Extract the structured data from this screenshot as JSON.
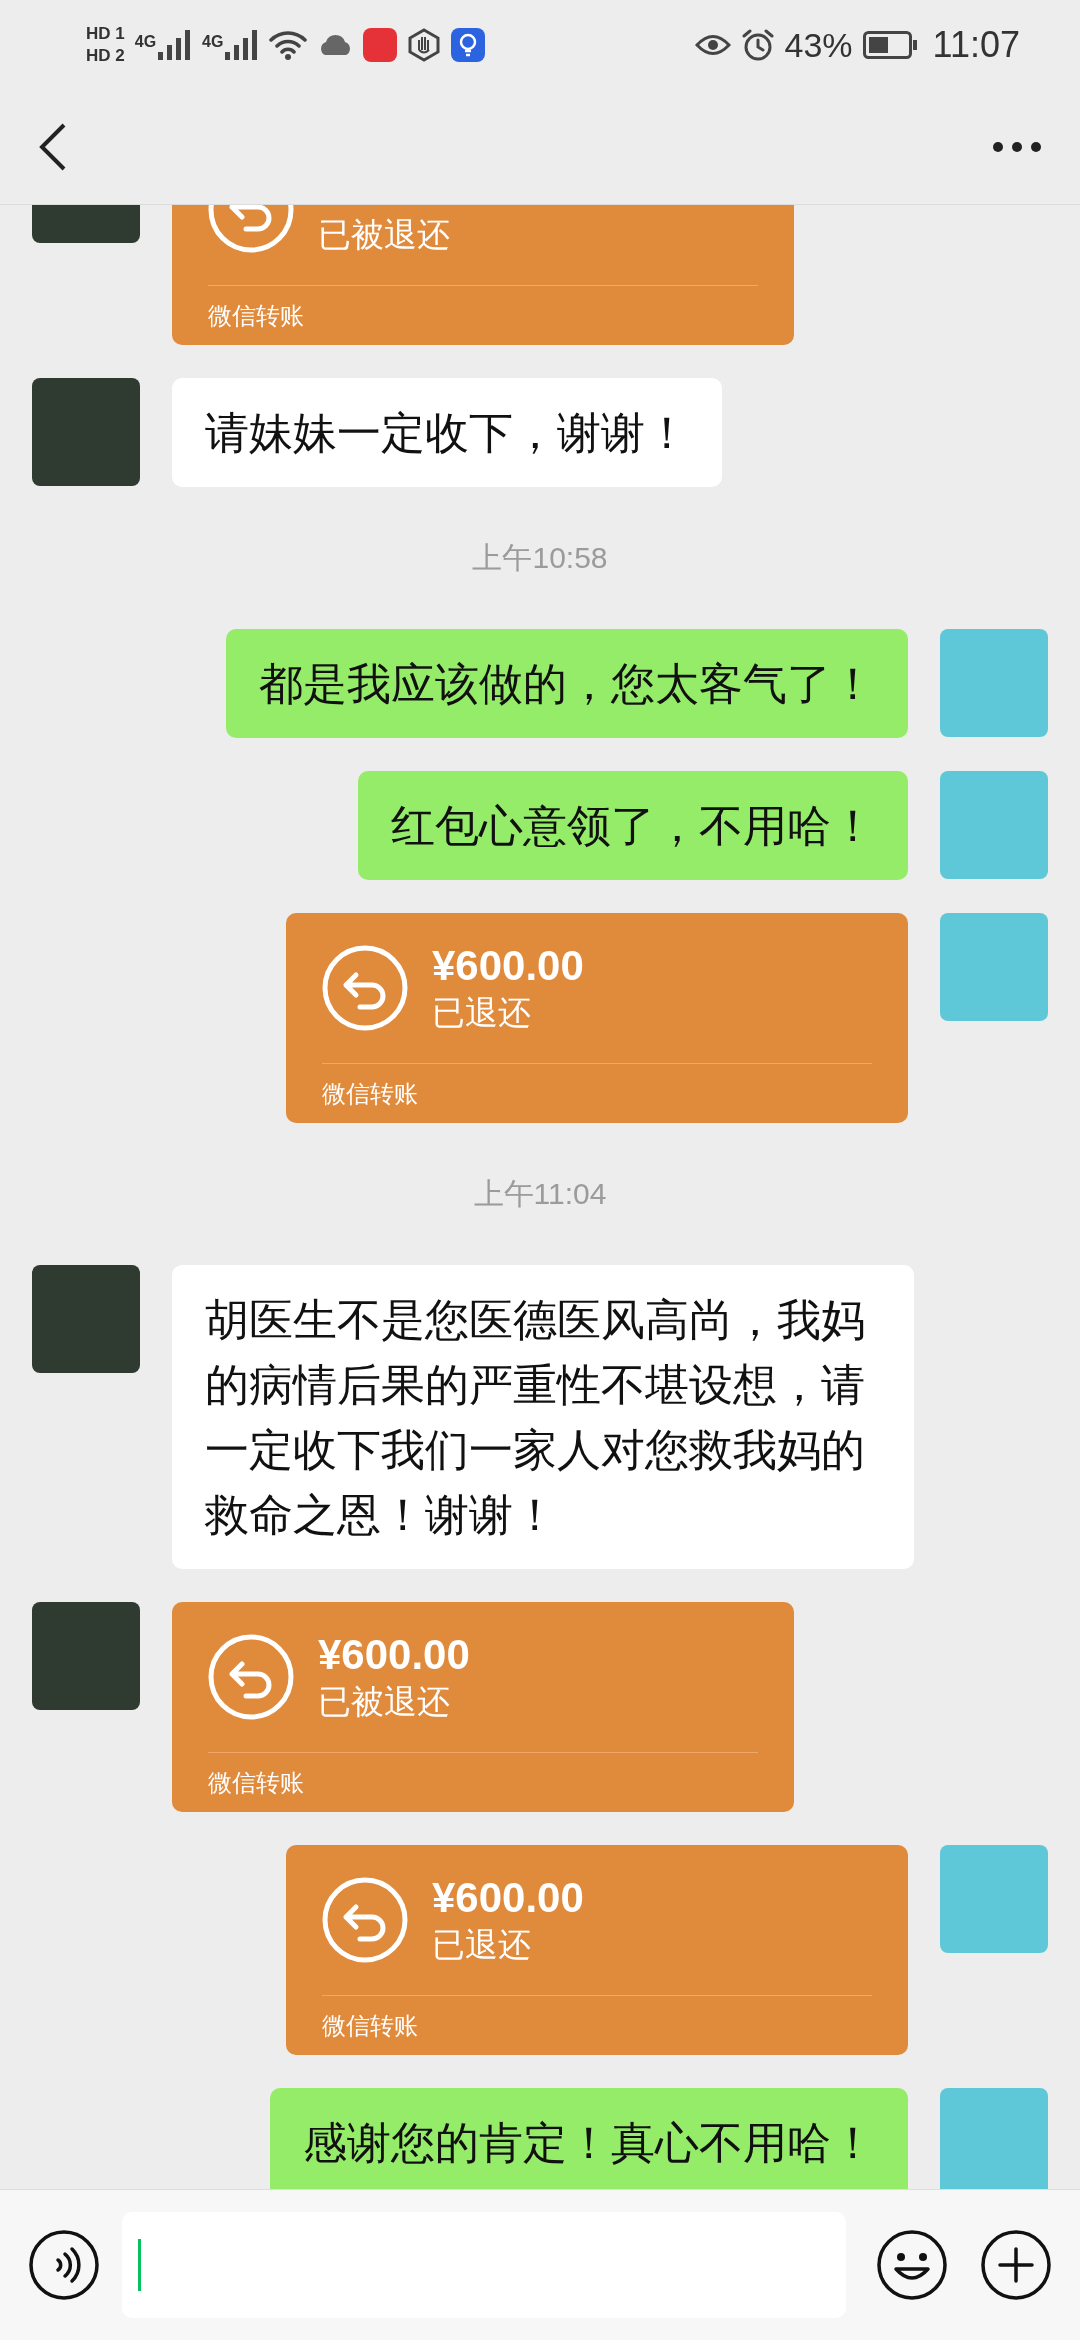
{
  "status_bar": {
    "sims": [
      {
        "label": "HD",
        "slot": "1"
      },
      {
        "label": "HD",
        "slot": "2"
      }
    ],
    "networks": [
      "4G",
      "4G"
    ],
    "battery": "43%",
    "time": "11:07"
  },
  "messages": [
    {
      "kind": "transfer",
      "outgoing": false,
      "status": "已被退还",
      "label": "微信转账"
    },
    {
      "kind": "text",
      "outgoing": false,
      "text": "请妹妹一定收下，谢谢！"
    },
    {
      "kind": "time",
      "text": "上午10:58"
    },
    {
      "kind": "text",
      "outgoing": true,
      "text": "都是我应该做的，您太客气了！"
    },
    {
      "kind": "text",
      "outgoing": true,
      "text": "红包心意领了，不用哈！"
    },
    {
      "kind": "transfer",
      "outgoing": true,
      "amount": "¥600.00",
      "status": "已退还",
      "label": "微信转账"
    },
    {
      "kind": "time",
      "text": "上午11:04"
    },
    {
      "kind": "text",
      "outgoing": false,
      "text": "胡医生不是您医德医风高尚，我妈的病情后果的严重性不堪设想，请一定收下我们一家人对您救我妈的救命之恩！谢谢！"
    },
    {
      "kind": "transfer",
      "outgoing": false,
      "amount": "¥600.00",
      "status": "已被退还",
      "label": "微信转账"
    },
    {
      "kind": "transfer",
      "outgoing": true,
      "amount": "¥600.00",
      "status": "已退还",
      "label": "微信转账"
    },
    {
      "kind": "text",
      "outgoing": true,
      "text": "感谢您的肯定！真心不用哈！"
    }
  ]
}
